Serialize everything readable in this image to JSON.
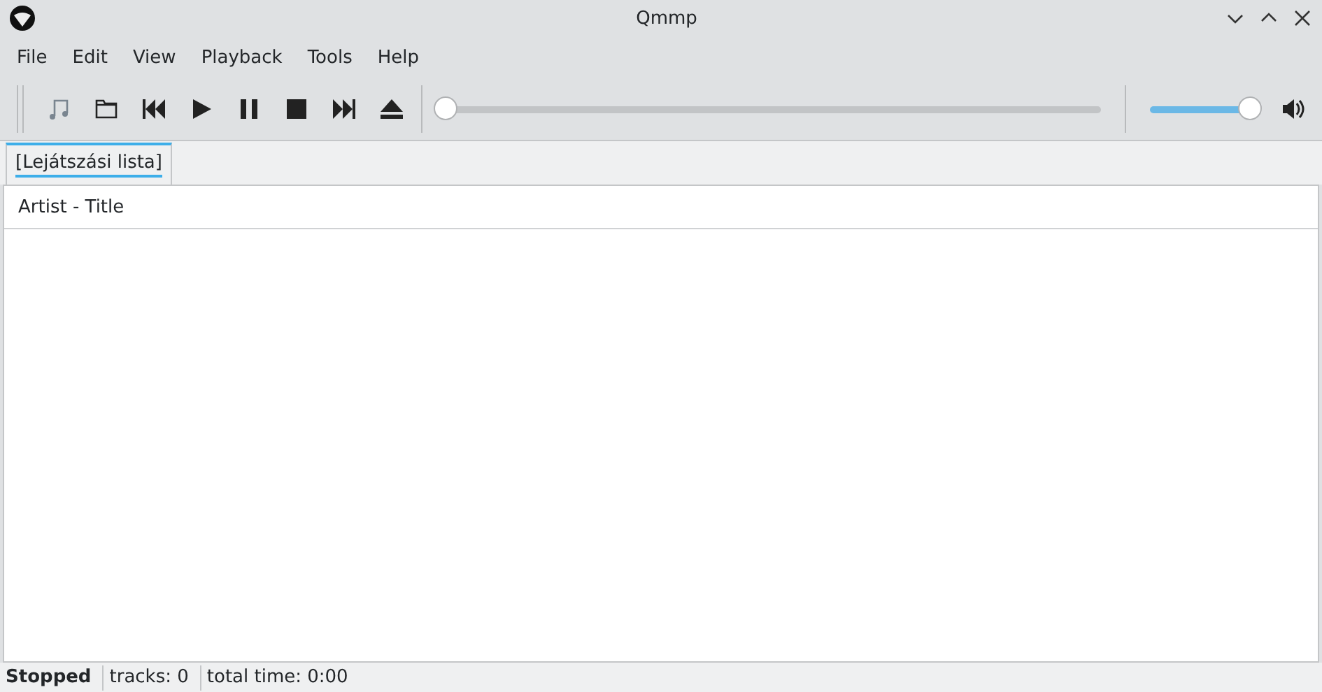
{
  "window": {
    "title": "Qmmp"
  },
  "menu": [
    "File",
    "Edit",
    "View",
    "Playback",
    "Tools",
    "Help"
  ],
  "seek": {
    "level": 0
  },
  "volume": {
    "level": 1
  },
  "tabs": [
    {
      "label": "[Lejátszási lista]",
      "selected": true
    }
  ],
  "playlist": {
    "columns": [
      "Artist - Title"
    ]
  },
  "status_bar": {
    "state": "Stopped",
    "tracks": "tracks: 0",
    "total_time": "total time: 0:00"
  }
}
